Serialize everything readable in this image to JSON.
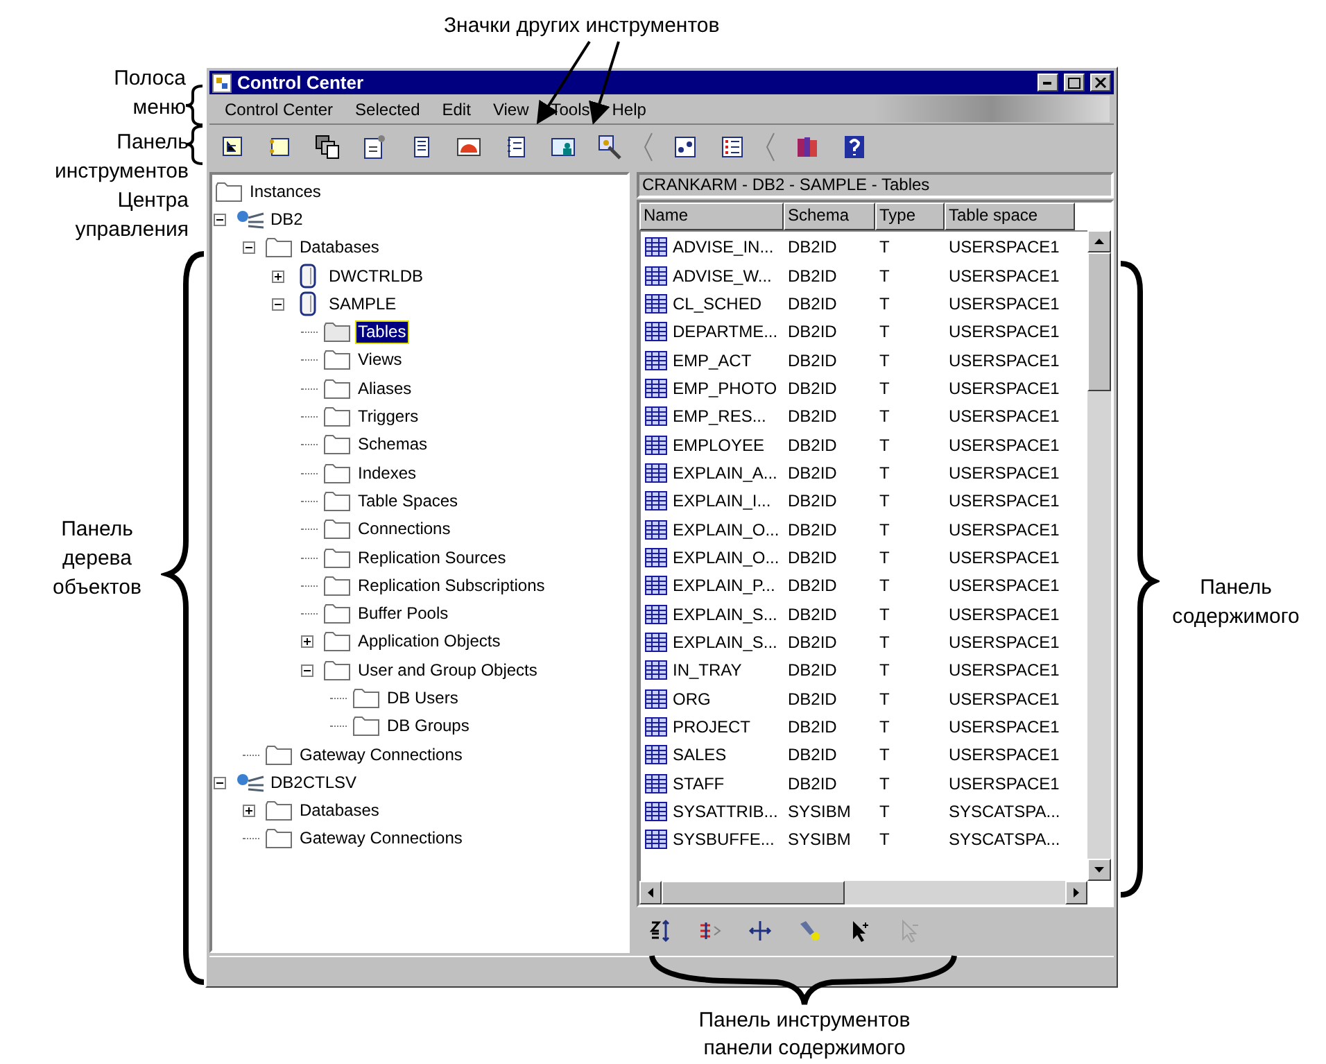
{
  "annotations": {
    "top": "Значки других инструментов",
    "menu_bar": "Полоса\nменю",
    "toolbar": "Панель\nинструментов\nЦентра\nуправления",
    "tree_pane": "Панель\nдерева\nобъектов",
    "contents_pane": "Панель\nсодержимого",
    "contents_toolbar": "Панель инструментов\nпанели содержимого"
  },
  "window": {
    "title": "Control Center"
  },
  "menu": [
    "Control Center",
    "Selected",
    "Edit",
    "View",
    "Tools",
    "Help"
  ],
  "tree": {
    "label": "Instances",
    "kind": "folder",
    "selected": false,
    "children": [
      {
        "label": "DB2",
        "kind": "instance",
        "expanded": true,
        "selected": false,
        "children": [
          {
            "label": "Databases",
            "kind": "folder",
            "expanded": true,
            "selected": false,
            "children": [
              {
                "label": "DWCTRLDB",
                "kind": "database",
                "expanded": false,
                "selected": false
              },
              {
                "label": "SAMPLE",
                "kind": "database",
                "expanded": true,
                "selected": false,
                "children": [
                  {
                    "label": "Tables",
                    "kind": "folder",
                    "selected": true
                  },
                  {
                    "label": "Views",
                    "kind": "folder",
                    "selected": false
                  },
                  {
                    "label": "Aliases",
                    "kind": "folder",
                    "selected": false
                  },
                  {
                    "label": "Triggers",
                    "kind": "folder",
                    "selected": false
                  },
                  {
                    "label": "Schemas",
                    "kind": "folder",
                    "selected": false
                  },
                  {
                    "label": "Indexes",
                    "kind": "folder",
                    "selected": false
                  },
                  {
                    "label": "Table Spaces",
                    "kind": "folder",
                    "selected": false
                  },
                  {
                    "label": "Connections",
                    "kind": "folder",
                    "selected": false
                  },
                  {
                    "label": "Replication Sources",
                    "kind": "folder",
                    "selected": false
                  },
                  {
                    "label": "Replication Subscriptions",
                    "kind": "folder",
                    "selected": false
                  },
                  {
                    "label": "Buffer Pools",
                    "kind": "folder",
                    "selected": false
                  },
                  {
                    "label": "Application Objects",
                    "kind": "folder",
                    "expanded": false,
                    "selected": false
                  },
                  {
                    "label": "User and Group Objects",
                    "kind": "folder",
                    "expanded": true,
                    "selected": false,
                    "children": [
                      {
                        "label": "DB Users",
                        "kind": "folder",
                        "selected": false
                      },
                      {
                        "label": "DB Groups",
                        "kind": "folder",
                        "selected": false
                      }
                    ]
                  }
                ]
              }
            ]
          },
          {
            "label": "Gateway Connections",
            "kind": "folder",
            "selected": false
          }
        ]
      },
      {
        "label": "DB2CTLSV",
        "kind": "instance",
        "expanded": true,
        "selected": false,
        "children": [
          {
            "label": "Databases",
            "kind": "folder",
            "expanded": false,
            "selected": false
          },
          {
            "label": "Gateway Connections",
            "kind": "folder",
            "selected": false
          }
        ]
      }
    ]
  },
  "contents": {
    "title": "CRANKARM - DB2 - SAMPLE - Tables",
    "columns": [
      "Name",
      "Schema",
      "Type",
      "Table space"
    ],
    "rows": [
      [
        "ADVISE_IN...",
        "DB2ID",
        "T",
        "USERSPACE1"
      ],
      [
        "ADVISE_W...",
        "DB2ID",
        "T",
        "USERSPACE1"
      ],
      [
        "CL_SCHED",
        "DB2ID",
        "T",
        "USERSPACE1"
      ],
      [
        "DEPARTME...",
        "DB2ID",
        "T",
        "USERSPACE1"
      ],
      [
        "EMP_ACT",
        "DB2ID",
        "T",
        "USERSPACE1"
      ],
      [
        "EMP_PHOTO",
        "DB2ID",
        "T",
        "USERSPACE1"
      ],
      [
        "EMP_RES...",
        "DB2ID",
        "T",
        "USERSPACE1"
      ],
      [
        "EMPLOYEE",
        "DB2ID",
        "T",
        "USERSPACE1"
      ],
      [
        "EXPLAIN_A...",
        "DB2ID",
        "T",
        "USERSPACE1"
      ],
      [
        "EXPLAIN_I...",
        "DB2ID",
        "T",
        "USERSPACE1"
      ],
      [
        "EXPLAIN_O...",
        "DB2ID",
        "T",
        "USERSPACE1"
      ],
      [
        "EXPLAIN_O...",
        "DB2ID",
        "T",
        "USERSPACE1"
      ],
      [
        "EXPLAIN_P...",
        "DB2ID",
        "T",
        "USERSPACE1"
      ],
      [
        "EXPLAIN_S...",
        "DB2ID",
        "T",
        "USERSPACE1"
      ],
      [
        "EXPLAIN_S...",
        "DB2ID",
        "T",
        "USERSPACE1"
      ],
      [
        "IN_TRAY",
        "DB2ID",
        "T",
        "USERSPACE1"
      ],
      [
        "ORG",
        "DB2ID",
        "T",
        "USERSPACE1"
      ],
      [
        "PROJECT",
        "DB2ID",
        "T",
        "USERSPACE1"
      ],
      [
        "SALES",
        "DB2ID",
        "T",
        "USERSPACE1"
      ],
      [
        "STAFF",
        "DB2ID",
        "T",
        "USERSPACE1"
      ],
      [
        "SYSATTRIB...",
        "SYSIBM",
        "T",
        "SYSCATSPA..."
      ],
      [
        "SYSBUFFE...",
        "SYSIBM",
        "T",
        "SYSCATSPA..."
      ]
    ]
  }
}
